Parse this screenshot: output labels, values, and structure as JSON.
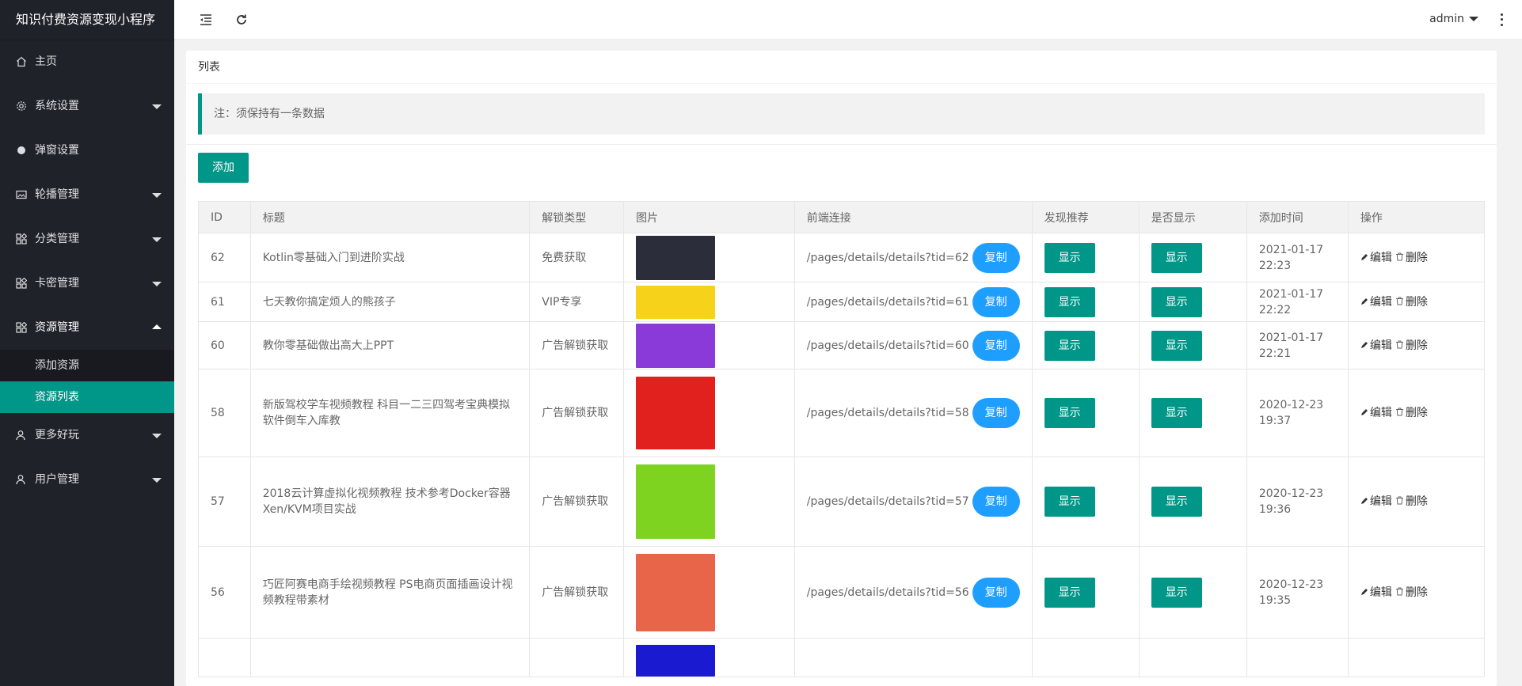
{
  "app": {
    "title": "知识付费资源变现小程序"
  },
  "sidebar": {
    "items": [
      {
        "label": "主页",
        "icon": "home-icon",
        "expandable": false
      },
      {
        "label": "系统设置",
        "icon": "gear-icon",
        "expandable": true
      },
      {
        "label": "弹窗设置",
        "icon": "circle-icon",
        "expandable": false
      },
      {
        "label": "轮播管理",
        "icon": "image-icon",
        "expandable": true
      },
      {
        "label": "分类管理",
        "icon": "apps-icon",
        "expandable": true
      },
      {
        "label": "卡密管理",
        "icon": "apps-icon",
        "expandable": true
      },
      {
        "label": "资源管理",
        "icon": "apps-icon",
        "expandable": true,
        "open": true
      },
      {
        "label": "更多好玩",
        "icon": "user-icon",
        "expandable": true
      },
      {
        "label": "用户管理",
        "icon": "user-icon",
        "expandable": true
      }
    ],
    "subitems": [
      {
        "label": "添加资源",
        "active": false
      },
      {
        "label": "资源列表",
        "active": true
      }
    ]
  },
  "header": {
    "username": "admin"
  },
  "card": {
    "title": "列表",
    "notice": "注：须保持有一条数据",
    "add_label": "添加"
  },
  "table": {
    "columns": [
      "ID",
      "标题",
      "解锁类型",
      "图片",
      "前端连接",
      "发现推荐",
      "是否显示",
      "添加时间",
      "操作"
    ],
    "copy_label": "复制",
    "show_label": "显示",
    "edit_label": "编辑",
    "delete_label": "删除",
    "rows": [
      {
        "id": "62",
        "title": "Kotlin零基础入门到进阶实战",
        "unlock": "免费获取",
        "link": "/pages/details/details?tid=62",
        "time": "2021-01-17 22:23",
        "thumb_color": "#2b2d3a",
        "thumb_h": 56
      },
      {
        "id": "61",
        "title": "七天教你搞定烦人的熊孩子",
        "unlock": "VIP专享",
        "link": "/pages/details/details?tid=61",
        "time": "2021-01-17 22:22",
        "thumb_color": "#f6d21a",
        "thumb_h": 42
      },
      {
        "id": "60",
        "title": "教你零基础做出高大上PPT",
        "unlock": "广告解锁获取",
        "link": "/pages/details/details?tid=60",
        "time": "2021-01-17 22:21",
        "thumb_color": "#8a3ad8",
        "thumb_h": 56
      },
      {
        "id": "58",
        "title": "新版驾校学车视频教程 科目一二三四驾考宝典模拟软件倒车入库教",
        "unlock": "广告解锁获取",
        "link": "/pages/details/details?tid=58",
        "time": "2020-12-23 19:37",
        "thumb_color": "#e0211e",
        "thumb_h": 92
      },
      {
        "id": "57",
        "title": "2018云计算虚拟化视频教程 技术参考Docker容器Xen/KVM项目实战",
        "unlock": "广告解锁获取",
        "link": "/pages/details/details?tid=57",
        "time": "2020-12-23 19:36",
        "thumb_color": "#7ed321",
        "thumb_h": 94
      },
      {
        "id": "56",
        "title": "巧匠阿赛电商手绘视频教程 PS电商页面插画设计视频教程带素材",
        "unlock": "广告解锁获取",
        "link": "/pages/details/details?tid=56",
        "time": "2020-12-23 19:35",
        "thumb_color": "#e8654a",
        "thumb_h": 98
      },
      {
        "id": "",
        "title": "",
        "unlock": "",
        "link": "",
        "time": "",
        "thumb_color": "#1a1ad0",
        "thumb_h": 40
      }
    ]
  }
}
